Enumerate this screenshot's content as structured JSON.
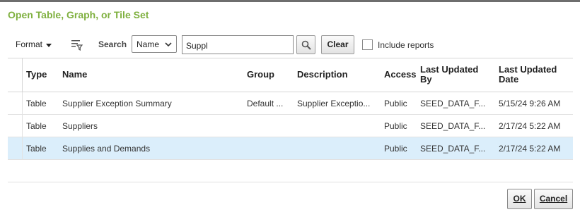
{
  "dialog": {
    "title": "Open Table, Graph, or Tile Set"
  },
  "toolbar": {
    "format_label": "Format",
    "search_label": "Search",
    "search_by": "Name",
    "search_value": "Suppl",
    "clear_label": "Clear",
    "include_reports_label": "Include reports",
    "include_reports_checked": false
  },
  "table": {
    "columns": [
      "Type",
      "Name",
      "Group",
      "Description",
      "Access",
      "Last Updated By",
      "Last Updated Date"
    ],
    "rows": [
      {
        "type": "Table",
        "name": "Supplier Exception Summary",
        "group": "Default ...",
        "description": "Supplier Exceptio...",
        "access": "Public",
        "updated_by": "SEED_DATA_F...",
        "updated_date": "5/15/24 9:26 AM",
        "selected": false
      },
      {
        "type": "Table",
        "name": "Suppliers",
        "group": "",
        "description": "",
        "access": "Public",
        "updated_by": "SEED_DATA_F...",
        "updated_date": "2/17/24 5:22 AM",
        "selected": false
      },
      {
        "type": "Table",
        "name": "Supplies and Demands",
        "group": "",
        "description": "",
        "access": "Public",
        "updated_by": "SEED_DATA_F...",
        "updated_date": "2/17/24 5:22 AM",
        "selected": true
      }
    ]
  },
  "footer": {
    "ok_label": "OK",
    "cancel_label": "Cancel"
  },
  "colors": {
    "title": "#7fb03f",
    "selected_row": "#dbeefb"
  },
  "icons": [
    "caret-down-icon",
    "filter-icon",
    "chevron-down-icon",
    "search-icon"
  ]
}
